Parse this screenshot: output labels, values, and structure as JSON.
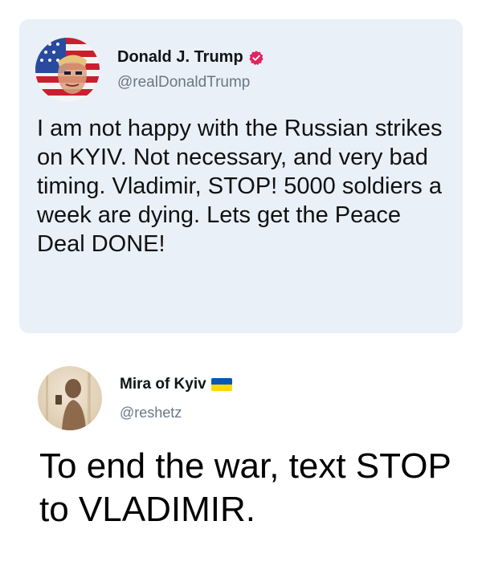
{
  "quoted_tweet": {
    "author_name": "Donald J. Trump",
    "handle": "@realDonaldTrump",
    "verified_icon": "verified-badge-icon",
    "text": "I am not happy with the Russian strikes on KYIV. Not necessary, and very bad timing. Vladimir, STOP! 5000 soldiers a week are dying. Lets get the Peace Deal DONE!",
    "background_color": "#e9f0f7",
    "verified_color": "#e0245e"
  },
  "reply_tweet": {
    "author_name": "Mira of Kyiv",
    "handle": "@reshetz",
    "flag_icon": "ukraine-flag-icon",
    "text": "To end the war, text STOP to VLADIMIR."
  }
}
